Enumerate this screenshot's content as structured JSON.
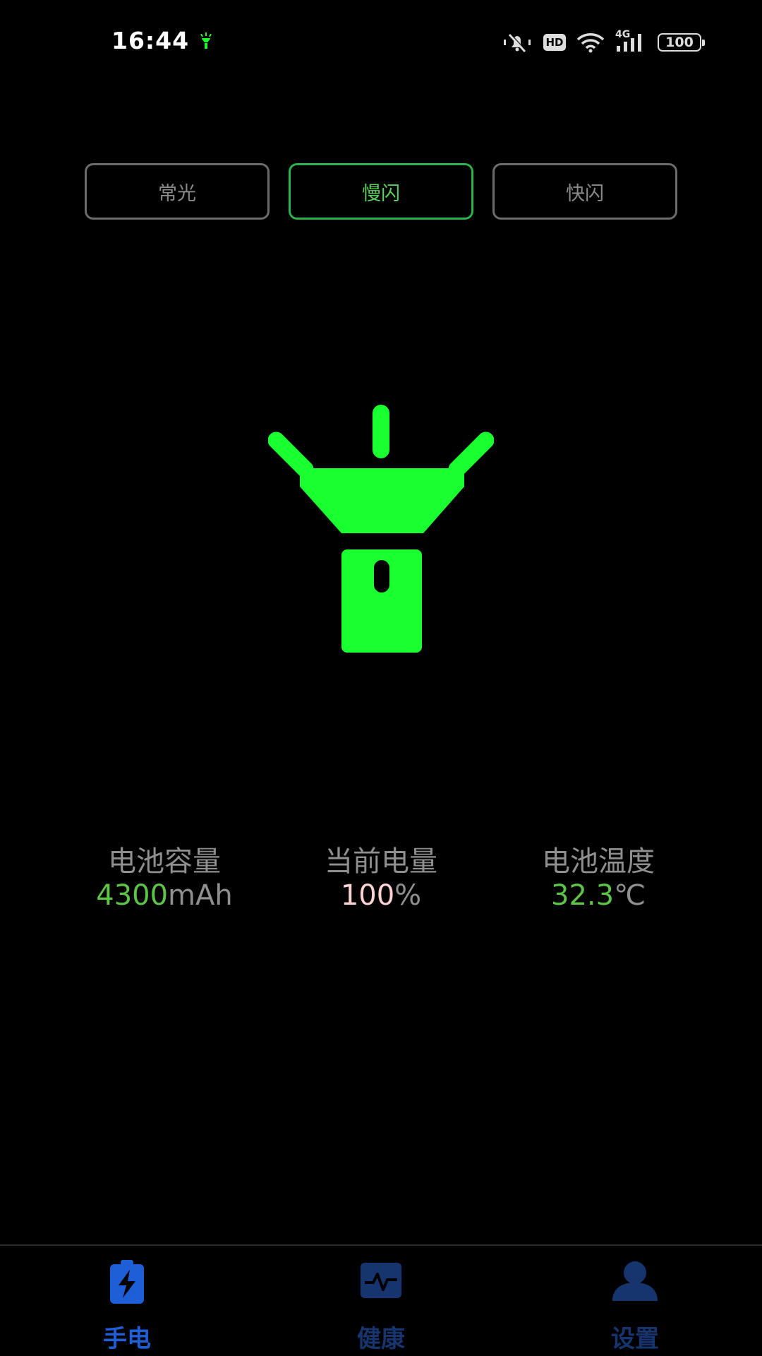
{
  "status_bar": {
    "time": "16:44",
    "hd_label": "HD",
    "network_label": "4G",
    "battery_level": "100"
  },
  "modes": {
    "items": [
      {
        "label": "常光",
        "active": false
      },
      {
        "label": "慢闪",
        "active": true
      },
      {
        "label": "快闪",
        "active": false
      }
    ]
  },
  "torch": {
    "icon": "flashlight-icon",
    "color": "#1aff2f"
  },
  "stats": [
    {
      "label": "电池容量",
      "value": "4300",
      "unit": "mAh",
      "value_color": "#5cc548"
    },
    {
      "label": "当前电量",
      "value": "100",
      "unit": "%",
      "value_color": "#ffd3d3"
    },
    {
      "label": "电池温度",
      "value": "32.3",
      "unit": "℃",
      "value_color": "#5cc548"
    }
  ],
  "nav": {
    "items": [
      {
        "label": "手电",
        "icon": "battery-bolt-icon",
        "color": "#1e5fd7",
        "active": true
      },
      {
        "label": "健康",
        "icon": "health-monitor-icon",
        "color": "#16346d",
        "active": false
      },
      {
        "label": "设置",
        "icon": "person-icon",
        "color": "#16346d",
        "active": false
      }
    ]
  },
  "colors": {
    "background": "#000000",
    "accent_green": "#2bb24c",
    "inactive_border": "#6b6b6b",
    "nav_active": "#1e5fd7",
    "nav_inactive": "#16346d"
  }
}
